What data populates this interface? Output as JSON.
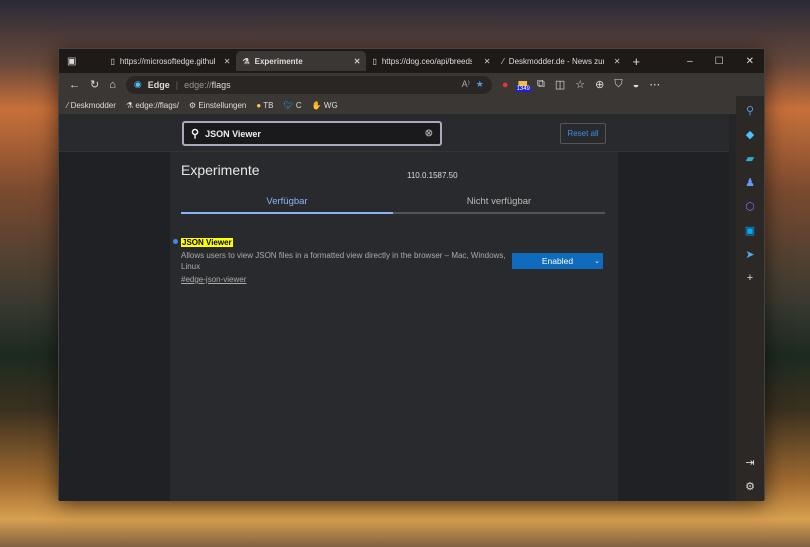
{
  "tabs": [
    {
      "label": "https://microsoftedge.github.io",
      "icon": "page-icon"
    },
    {
      "label": "Experimente",
      "icon": "flask-icon",
      "active": true
    },
    {
      "label": "https://dog.ceo/api/breeds/l",
      "icon": "page-icon"
    },
    {
      "label": "Deskmodder.de - News zum",
      "icon": "deskmodder-icon"
    }
  ],
  "address": {
    "site": "Edge",
    "url_prefix": "edge://",
    "url_host": "flags",
    "badge": "1349"
  },
  "bookmarks": [
    "Deskmodder",
    "edge://flags/",
    "Einstellungen",
    "TB",
    "C",
    "WG"
  ],
  "page": {
    "search_value": "JSON Viewer",
    "reset": "Reset all",
    "title": "Experimente",
    "version": "110.0.1587.50",
    "tabs": [
      "Verfügbar",
      "Nicht verfügbar"
    ],
    "flag": {
      "name": "JSON Viewer",
      "desc": "Allows users to view JSON files in a formatted view directly in the browser – Mac, Windows, Linux",
      "link": "#edge-json-viewer",
      "value": "Enabled"
    }
  },
  "colors": {
    "accent": "#0f6cbd",
    "highlight": "#ffff00",
    "link_tab": "#8ab4f8"
  }
}
